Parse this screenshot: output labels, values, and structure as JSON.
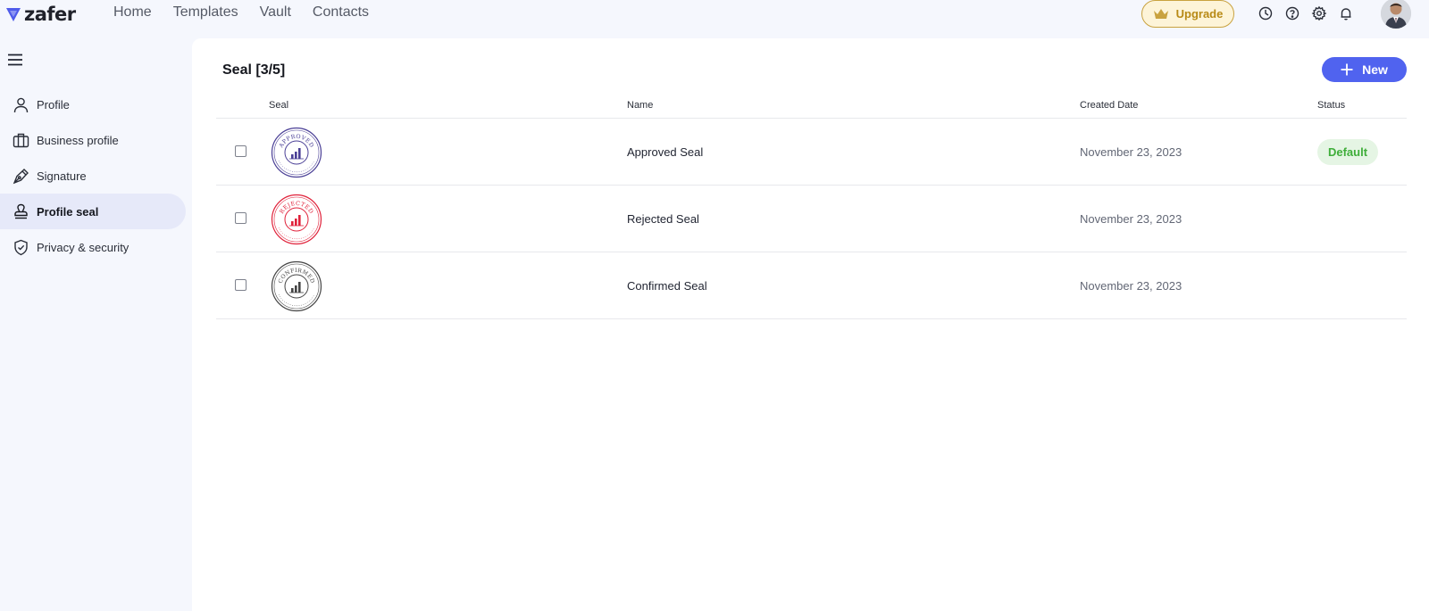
{
  "brand": {
    "name": "zafer",
    "color": "#4f5bea"
  },
  "nav": [
    "Home",
    "Templates",
    "Vault",
    "Contacts"
  ],
  "upgrade": {
    "label": "Upgrade"
  },
  "top_icons": [
    "clock-icon",
    "help-icon",
    "gear-icon",
    "bell-icon"
  ],
  "sidebar": {
    "items": [
      {
        "label": "Profile",
        "icon": "user-icon"
      },
      {
        "label": "Business profile",
        "icon": "briefcase-icon"
      },
      {
        "label": "Signature",
        "icon": "pen-nib-icon"
      },
      {
        "label": "Profile seal",
        "icon": "stamp-icon",
        "active": true
      },
      {
        "label": "Privacy & security",
        "icon": "shield-check-icon"
      }
    ]
  },
  "main": {
    "title": "Seal [3/5]",
    "new_button": "New",
    "columns": [
      "Seal",
      "Name",
      "Created Date",
      "Status"
    ],
    "rows": [
      {
        "seal_text": "APPROVED",
        "seal_color": "#4a3f96",
        "name": "Approved Seal",
        "created": "November 23, 2023",
        "status": "Default"
      },
      {
        "seal_text": "REJECTED",
        "seal_color": "#e0213a",
        "name": "Rejected Seal",
        "created": "November 23, 2023",
        "status": ""
      },
      {
        "seal_text": "CONFIRMED",
        "seal_color": "#444444",
        "name": "Confirmed Seal",
        "created": "November 23, 2023",
        "status": ""
      }
    ]
  }
}
